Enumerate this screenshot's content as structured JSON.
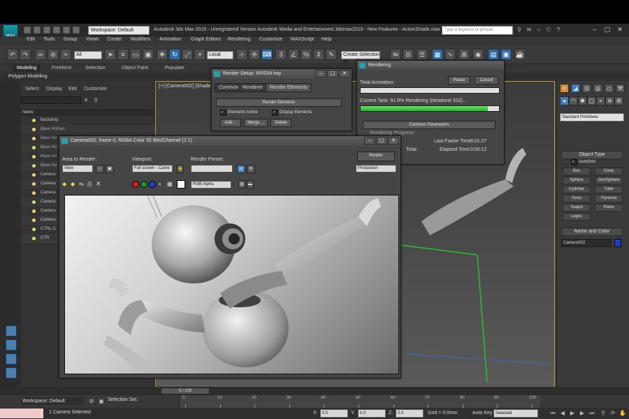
{
  "titlebar": {
    "workspace": "Workspace: Default",
    "title": "Autodesk 3ds Max 2015 - Unregistered Version   Autodesk Media and Entertainment 3dsmax2015 - New Features - ActiveShade.max",
    "search_placeholder": "Type a keyword or phrase"
  },
  "menu": [
    "Edit",
    "Tools",
    "Group",
    "Views",
    "Create",
    "Modifiers",
    "Animation",
    "Graph Editors",
    "Rendering",
    "Customize",
    "MAXScript",
    "Help"
  ],
  "toolbar": {
    "filter": "All",
    "coord": "Local",
    "selection_set": "Create Selection Se"
  },
  "ribbon": {
    "tabs": [
      "Modeling",
      "Freeform",
      "Selection",
      "Object Paint",
      "Populate"
    ],
    "sub": "Polygon Modeling"
  },
  "explorer": {
    "tabs": [
      "Select",
      "Display",
      "Edit",
      "Customize"
    ],
    "column": "Name",
    "rows": [
      {
        "label": "Backdrop",
        "italic": false
      },
      {
        "label": "Base Human",
        "italic": true
      },
      {
        "label": "Base Hu",
        "italic": true
      },
      {
        "label": "Base Hu",
        "italic": true
      },
      {
        "label": "Base Hu",
        "italic": true
      },
      {
        "label": "Base Hu",
        "italic": true
      },
      {
        "label": "Camera",
        "italic": false
      },
      {
        "label": "Camera",
        "italic": false
      },
      {
        "label": "Camera",
        "italic": false
      },
      {
        "label": "Camera",
        "italic": false
      },
      {
        "label": "Camera",
        "italic": false
      },
      {
        "label": "Camera",
        "italic": false
      },
      {
        "label": "CTRL-C",
        "italic": false
      },
      {
        "label": "CTR",
        "italic": false
      }
    ]
  },
  "viewport": {
    "label": "[+] [Camera002] [Shade"
  },
  "command_panel": {
    "category": "Standard Primitives",
    "object_type_title": "Object Type",
    "autogrid": "AutoGrid",
    "primitives": [
      "Box",
      "Cone",
      "Sphere",
      "GeoSphere",
      "Cylinder",
      "Tube",
      "Torus",
      "Pyramid",
      "Teapot",
      "Plane",
      "Legos"
    ],
    "name_color_title": "Name and Color",
    "object_name": "Camera002",
    "object_color": "#1a3fc7"
  },
  "render_setup": {
    "title": "Render Setup: NVIDIA iray",
    "tabs": [
      "Common",
      "Renderer",
      "Render Elements"
    ],
    "section": "Render Elements",
    "elements_active": "Elements Active",
    "display_elements": "Display Elements",
    "add": "Add ...",
    "merge": "Merge ...",
    "delete": "Delete"
  },
  "rendering": {
    "title": "Rendering",
    "pause": "Pause",
    "cancel": "Cancel",
    "total_animation_label": "Total Animation:",
    "current_task": "Current Task:   91.9%  Rendering (Iteration# 310)...",
    "current_progress": 0.919,
    "common_params": "Common Parameters",
    "render_progress": "Rendering Progress:",
    "last_frame_label": "Last Frame Time:",
    "last_frame_value": "0:01:27",
    "elapsed_label": "Elapsed Time:",
    "elapsed_value": "0:00:12",
    "total_label": "Total"
  },
  "frame_window": {
    "title": "Camera002, frame 0, RGBA Color 32 Bits/Channel (1:1)",
    "area_label": "Area to Render:",
    "area_value": "View",
    "viewport_label": "Viewport:",
    "viewport_value": "Full screen - Came",
    "preset_label": "Render Preset:",
    "render_button": "Render",
    "mode_value": "Production",
    "channel_value": "RGB Alpha"
  },
  "bottom": {
    "time": "0 / 100",
    "workspace": "Workspace: Default",
    "selection_set_label": "Selection Set:",
    "ticks": [
      "0",
      "10",
      "20",
      "30",
      "40",
      "50",
      "60",
      "70",
      "80",
      "90",
      "100"
    ],
    "status": "1 Camera Selected",
    "x_label": "X:",
    "x_value": "0.0",
    "y_label": "Y:",
    "y_value": "0.0",
    "z_label": "Z:",
    "z_value": "0.0",
    "grid": "Grid = 0.0mm",
    "autokey": "Auto Key",
    "selected": "Selected"
  }
}
